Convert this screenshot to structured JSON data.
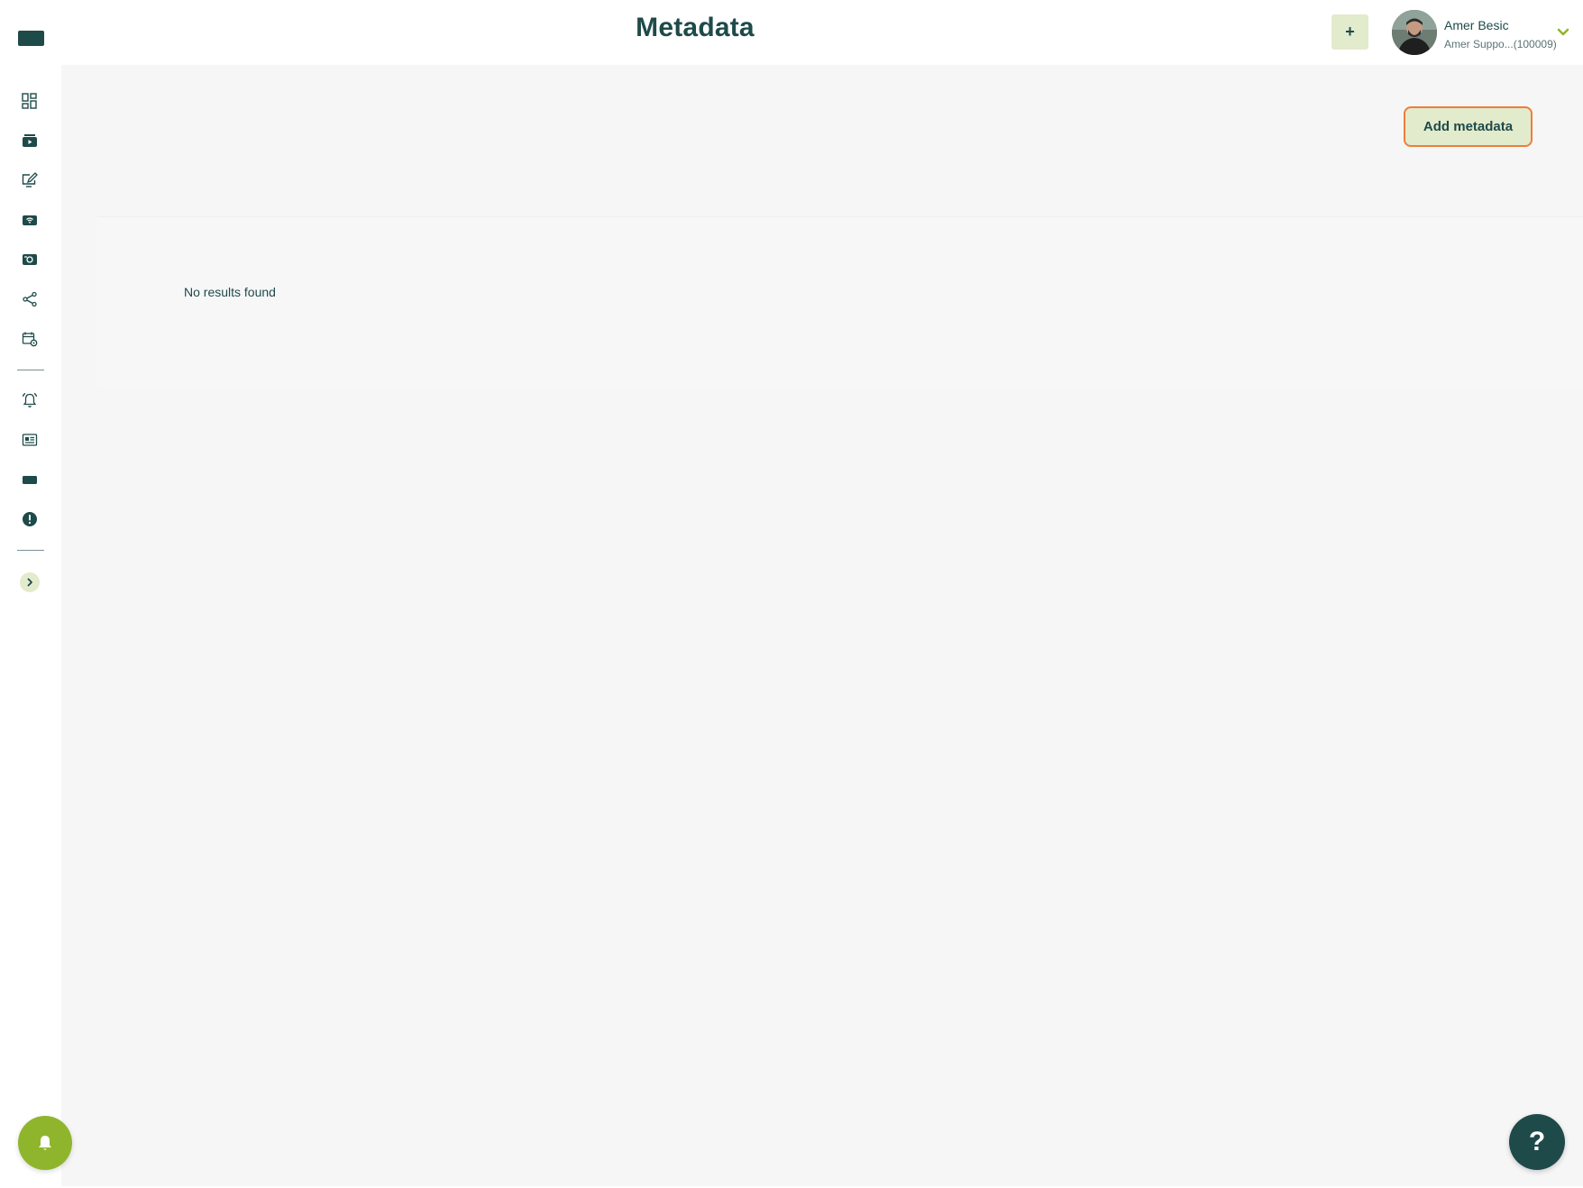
{
  "header": {
    "title": "Metadata",
    "plus_label": "+",
    "user": {
      "name": "Amer Besic",
      "subtitle": "Amer Suppo...(100009)"
    }
  },
  "sidebar": {
    "items": [
      {
        "icon": "dashboard-icon"
      },
      {
        "icon": "media-player-icon"
      },
      {
        "icon": "edit-screen-icon"
      },
      {
        "icon": "wifi-device-icon"
      },
      {
        "icon": "media-library-icon"
      },
      {
        "icon": "share-icon"
      },
      {
        "icon": "calendar-settings-icon"
      },
      {
        "icon": "alarm-bell-icon"
      },
      {
        "icon": "newspaper-icon"
      },
      {
        "icon": "display-block-icon"
      },
      {
        "icon": "alert-icon"
      }
    ]
  },
  "main": {
    "add_button_label": "Add metadata",
    "empty_message": "No results found",
    "help_label": "?"
  },
  "colors": {
    "primary": "#1e4a4a",
    "accent_green": "#8fb52c",
    "button_bg": "#e2ebcc",
    "focus_border": "#f07c3c",
    "content_bg": "#f6f6f6"
  }
}
